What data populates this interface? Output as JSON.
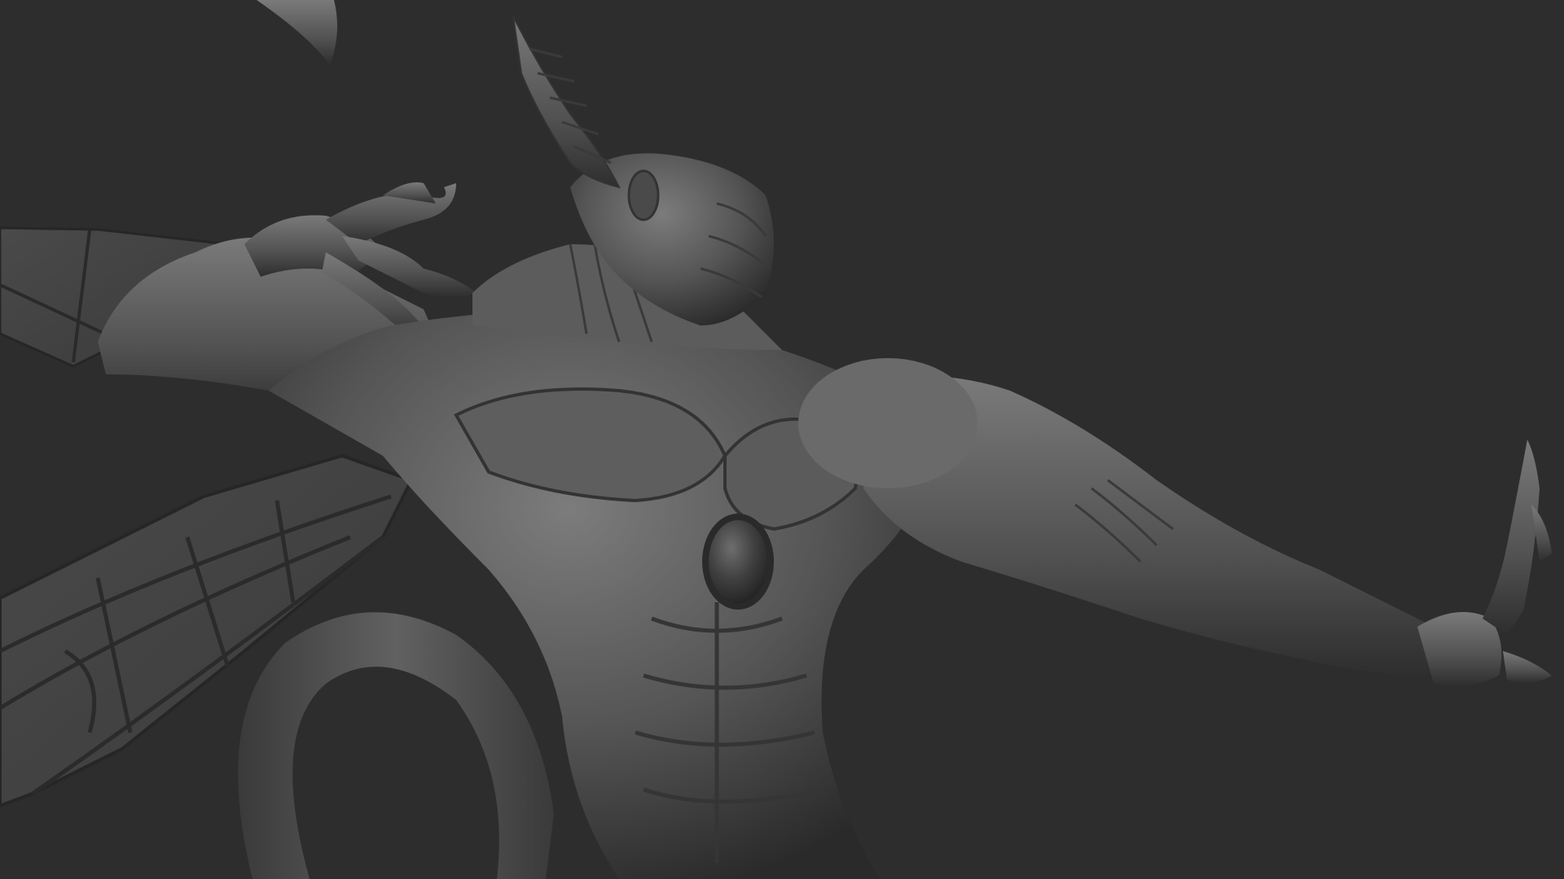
{
  "scene": {
    "background_color": "#2d2d2d",
    "material_base_color": "#5a5a5a",
    "material_highlight_color": "#8a8a8a",
    "material_shadow_color": "#262626",
    "subject": "sculpt-model"
  }
}
